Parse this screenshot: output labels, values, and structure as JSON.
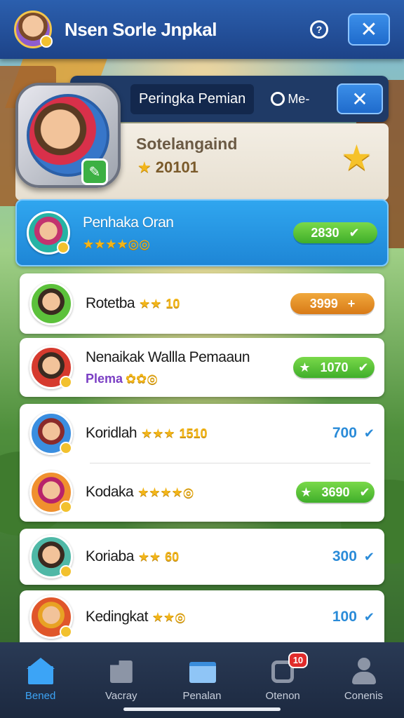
{
  "header": {
    "title": "Nsen Sorle Jnpkal",
    "help_icon": "help-circle-icon",
    "close_icon": "close-icon"
  },
  "panel": {
    "title": "Peringka Pemian",
    "sort_label": "Me-",
    "close_symbol": "✕"
  },
  "profile": {
    "name": "Sotelangaind",
    "score": "20101",
    "edit_symbol": "✎"
  },
  "leaderboard": [
    {
      "name": "Penhaka Oran",
      "rating": "★★★★◎◎",
      "score": "2830",
      "style": "green-pill",
      "check": "✔"
    },
    {
      "name": "Rotetba",
      "rating": "★★",
      "rating_num": "10",
      "score": "3999",
      "style": "orange-pill",
      "check": "+"
    },
    {
      "name": "Nenaikak Wallla Pemaaun",
      "tag": "Plema",
      "rating": "✿✿◎",
      "score": "1070",
      "style": "green-pill-star",
      "check": "✔"
    },
    {
      "name": "Koridlah",
      "rating": "★★★",
      "rating_num": "1510",
      "score": "700",
      "style": "plain",
      "check": "✔"
    },
    {
      "name": "Kodaka",
      "rating": "★★★★◎",
      "score": "3690",
      "style": "green-pill-star",
      "check": "✔"
    },
    {
      "name": "Koriaba",
      "rating": "★★",
      "rating_num": "60",
      "score": "300",
      "style": "plain",
      "check": "✔"
    },
    {
      "name": "Kedingkat",
      "rating": "★★◎",
      "score": "100",
      "style": "plain",
      "check": "✔"
    }
  ],
  "bottom_nav": [
    {
      "label": "Bened",
      "icon": "home-icon",
      "active": true
    },
    {
      "label": "Vacray",
      "icon": "folder-icon",
      "active": false
    },
    {
      "label": "Penalan",
      "icon": "building-icon",
      "active": false
    },
    {
      "label": "Otenon",
      "icon": "camera-icon",
      "badge": "10",
      "active": false
    },
    {
      "label": "Conenis",
      "icon": "profile-icon",
      "active": false
    }
  ],
  "colors": {
    "header_bg": "#1d4388",
    "active_row": "#1e86d6",
    "pill_green": "#3fae2a",
    "pill_orange": "#d87a17",
    "score_blue": "#2a8bd8",
    "nav_active": "#3ca4f6"
  }
}
